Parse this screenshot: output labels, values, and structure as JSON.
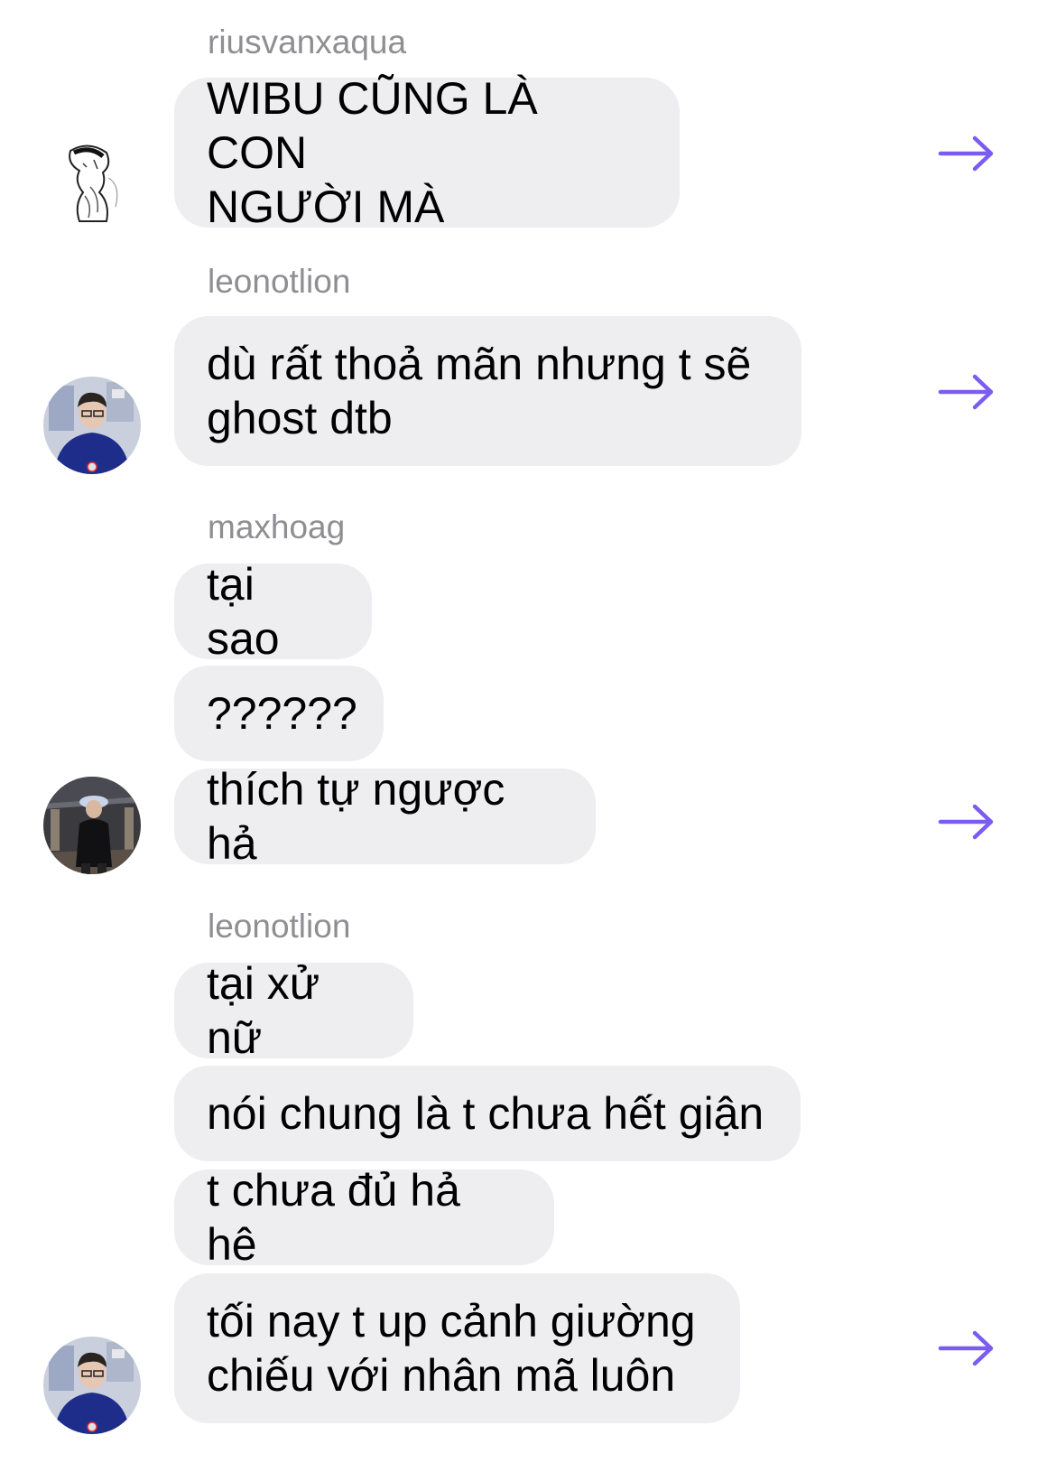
{
  "colors": {
    "bubble_bg": "#eeeef0",
    "sender_text": "#8e8e93",
    "share_arrow": "#7b5cf0"
  },
  "groups": [
    {
      "sender": "riusvanxaqua",
      "avatar_icon": "sketch-illustration-avatar",
      "messages": [
        "WIBU CŨNG LÀ CON\nNGƯỜI MÀ"
      ]
    },
    {
      "sender": "leonotlion",
      "avatar_icon": "person-photo-avatar",
      "messages": [
        "dù rất thoả mãn nhưng t sẽ\nghost dtb"
      ]
    },
    {
      "sender": "maxhoag",
      "avatar_icon": "person-photo-avatar",
      "messages": [
        "tại sao",
        " ??????",
        "thích tự ngược hả"
      ]
    },
    {
      "sender": "leonotlion",
      "avatar_icon": "person-photo-avatar",
      "messages": [
        "tại xử nữ",
        "nói chung là t chưa hết giận",
        "t chưa đủ hả hê",
        "tối nay t up cảnh giường\nchiếu với nhân mã luôn"
      ]
    }
  ],
  "share_icon": "right-arrow-icon"
}
